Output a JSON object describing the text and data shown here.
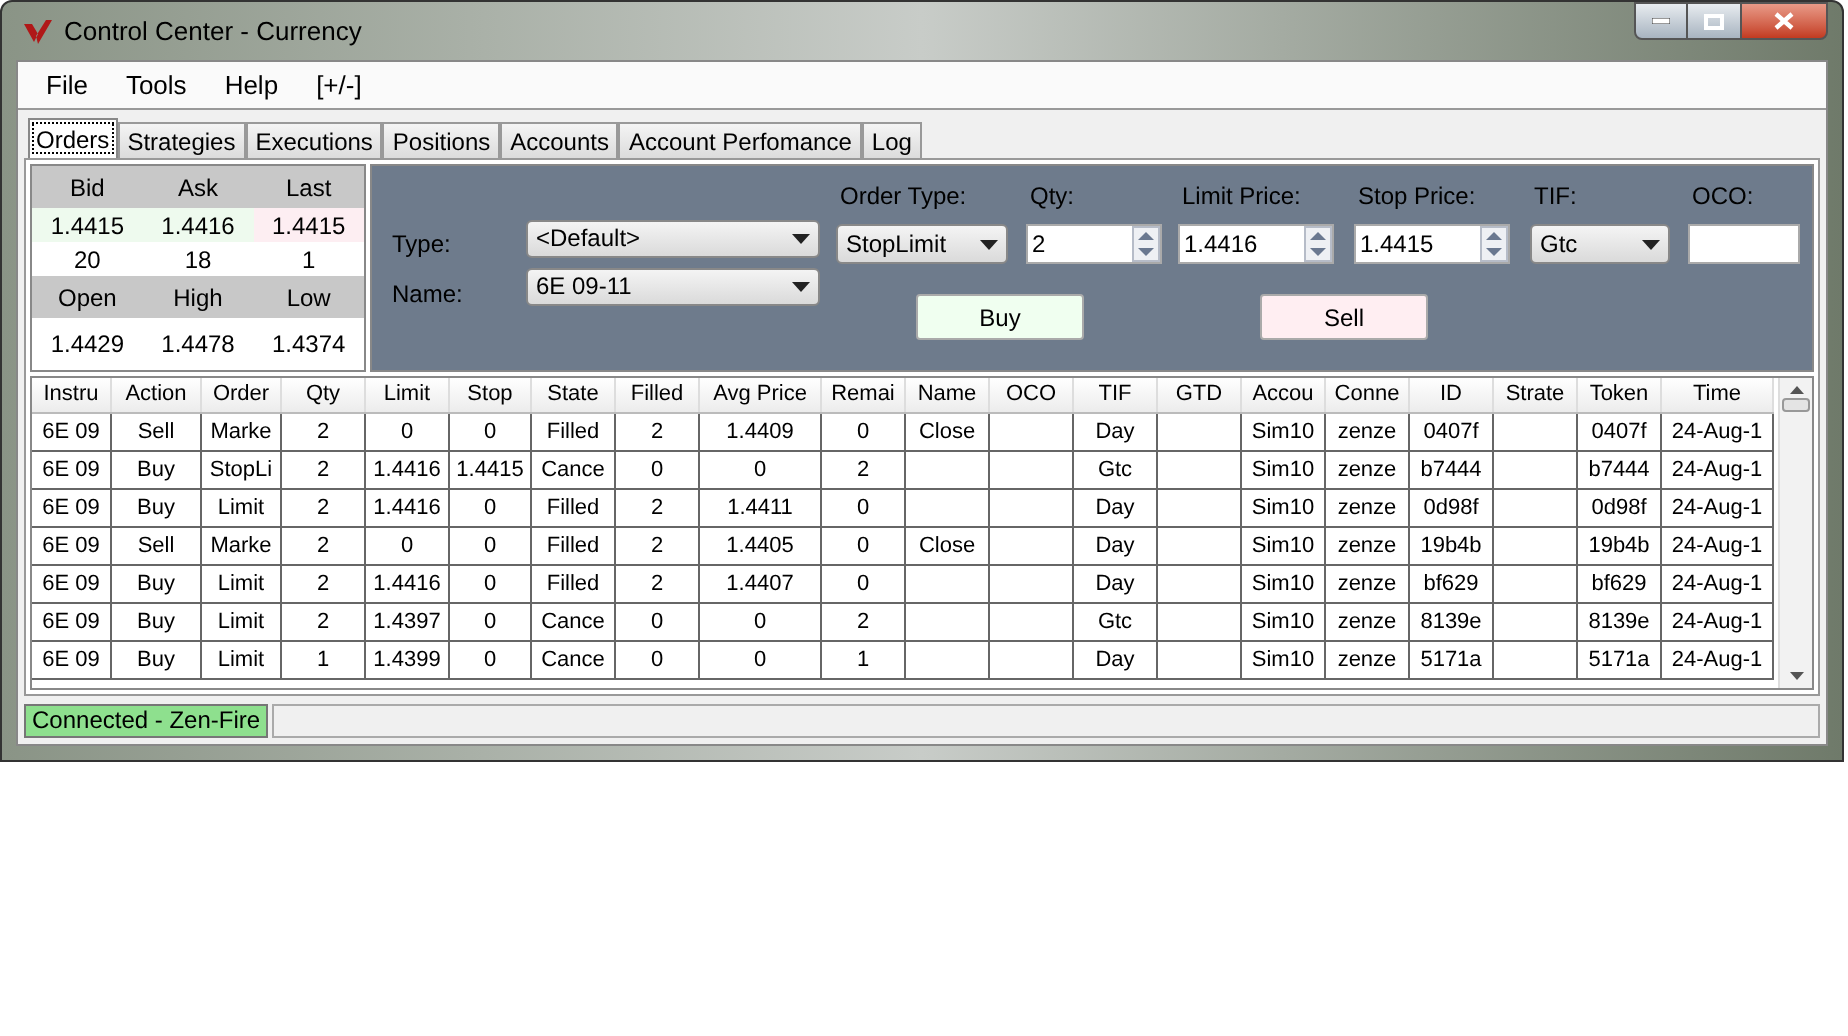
{
  "window": {
    "title": "Control Center - Currency"
  },
  "menu": [
    "File",
    "Tools",
    "Help",
    "[+/-]"
  ],
  "tabs": [
    {
      "label": "Orders",
      "selected": true
    },
    {
      "label": "Strategies",
      "selected": false
    },
    {
      "label": "Executions",
      "selected": false
    },
    {
      "label": "Positions",
      "selected": false
    },
    {
      "label": "Accounts",
      "selected": false
    },
    {
      "label": "Account Perfomance",
      "selected": false
    },
    {
      "label": "Log",
      "selected": false
    }
  ],
  "quote": {
    "headers": [
      "Bid",
      "Ask",
      "Last"
    ],
    "prices": [
      {
        "text": "1.4415",
        "color": "#eefaee"
      },
      {
        "text": "1.4416",
        "color": "#eefaee"
      },
      {
        "text": "1.4415",
        "color": "#fdeef2"
      }
    ],
    "sizes": [
      "20",
      "18",
      "1"
    ],
    "session_headers": [
      "Open",
      "High",
      "Low"
    ],
    "session_values": [
      "1.4429",
      "1.4478",
      "1.4374"
    ]
  },
  "order_entry": {
    "type_label": "Type:",
    "type_value": "<Default>",
    "name_label": "Name:",
    "name_value": "6E 09-11",
    "fields": [
      {
        "label": "Order Type:",
        "kind": "select",
        "value": "StopLimit"
      },
      {
        "label": "Qty:",
        "kind": "spin",
        "value": "2"
      },
      {
        "label": "Limit Price:",
        "kind": "spin",
        "value": "1.4416"
      },
      {
        "label": "Stop Price:",
        "kind": "spin",
        "value": "1.4415"
      },
      {
        "label": "TIF:",
        "kind": "select",
        "value": "Gtc"
      },
      {
        "label": "OCO:",
        "kind": "text"
      }
    ],
    "buttons": [
      {
        "label": "Buy",
        "color": "#f0fff0"
      },
      {
        "label": "Sell",
        "color": "#ffeef2"
      }
    ]
  },
  "table": {
    "columns": [
      "Instru",
      "Action",
      "Order",
      "Qty",
      "Limit",
      "Stop",
      "State",
      "Filled",
      "Avg Price",
      "Remai",
      "Name",
      "OCO",
      "TIF",
      "GTD",
      "Accou",
      "Conne",
      "ID",
      "Strate",
      "Token",
      "Time"
    ],
    "rows": [
      [
        "6E 09",
        "Sell",
        "Marke",
        "2",
        "0",
        "0",
        "Filled",
        "2",
        "1.4409",
        "0",
        "Close",
        "",
        "Day",
        "",
        "Sim10",
        "zenze",
        "0407f",
        "",
        "0407f",
        "24-Aug-1"
      ],
      [
        "6E 09",
        "Buy",
        "StopLi",
        "2",
        "1.4416",
        "1.4415",
        "Cance",
        "0",
        "0",
        "2",
        "",
        "",
        "Gtc",
        "",
        "Sim10",
        "zenze",
        "b7444",
        "",
        "b7444",
        "24-Aug-1"
      ],
      [
        "6E 09",
        "Buy",
        "Limit",
        "2",
        "1.4416",
        "0",
        "Filled",
        "2",
        "1.4411",
        "0",
        "",
        "",
        "Day",
        "",
        "Sim10",
        "zenze",
        "0d98f",
        "",
        "0d98f",
        "24-Aug-1"
      ],
      [
        "6E 09",
        "Sell",
        "Marke",
        "2",
        "0",
        "0",
        "Filled",
        "2",
        "1.4405",
        "0",
        "Close",
        "",
        "Day",
        "",
        "Sim10",
        "zenze",
        "19b4b",
        "",
        "19b4b",
        "24-Aug-1"
      ],
      [
        "6E 09",
        "Buy",
        "Limit",
        "2",
        "1.4416",
        "0",
        "Filled",
        "2",
        "1.4407",
        "0",
        "",
        "",
        "Day",
        "",
        "Sim10",
        "zenze",
        "bf629",
        "",
        "bf629",
        "24-Aug-1"
      ],
      [
        "6E 09",
        "Buy",
        "Limit",
        "2",
        "1.4397",
        "0",
        "Cance",
        "0",
        "0",
        "2",
        "",
        "",
        "Gtc",
        "",
        "Sim10",
        "zenze",
        "8139e",
        "",
        "8139e",
        "24-Aug-1"
      ],
      [
        "6E 09",
        "Buy",
        "Limit",
        "1",
        "1.4399",
        "0",
        "Cance",
        "0",
        "0",
        "1",
        "",
        "",
        "Day",
        "",
        "Sim10",
        "zenze",
        "5171a",
        "",
        "5171a",
        "24-Aug-1"
      ]
    ]
  },
  "status_bar": {
    "text": "Connected - Zen-Fire",
    "color": "#8ee08e"
  }
}
